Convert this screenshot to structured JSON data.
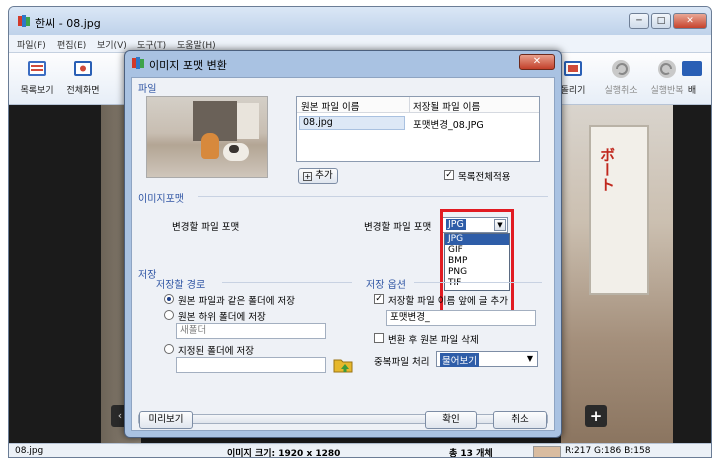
{
  "app": {
    "title": "한씨 - 08.jpg",
    "window_controls": [
      "─",
      "□",
      "✕"
    ],
    "menu": [
      "파일(F)",
      "편집(E)",
      "보기(V)",
      "도구(T)",
      "도움말(H)"
    ],
    "toolbar": {
      "left": [
        "목록보기",
        "전체화면"
      ],
      "right": [
        "돌리기",
        "실행취소",
        "실행반복",
        "배"
      ]
    },
    "viewer": {
      "sign_text": "ボート",
      "plus_label": "+",
      "arrow_label": "‹"
    },
    "status": {
      "filename": "08.jpg",
      "image_size": "이미지 크기: 1920 x 1280",
      "total": "총 13 개체",
      "color_readout": "R:217 G:186 B:158"
    }
  },
  "dialog": {
    "title": "이미지 포맷 변환",
    "close_label": "✕",
    "file_section": {
      "title": "파일",
      "col_original": "원본 파일 이름",
      "col_saved": "저장될 파일 이름",
      "rows": [
        {
          "original": "08.jpg",
          "saved": "포맷변경_08.JPG"
        }
      ],
      "add_label": "추가",
      "apply_all_label": "목록전체적용",
      "apply_all_checked": true
    },
    "format_section": {
      "title": "이미지포맷",
      "source_label": "변경할 파일 포맷",
      "target_label": "변경할 파일 포맷",
      "selected": "JPG",
      "options": [
        "JPG",
        "GIF",
        "BMP",
        "PNG",
        "TIF"
      ]
    },
    "save_section": {
      "title": "저장",
      "path_title": "저장할 경로",
      "options": [
        {
          "label": "원본 파일과 같은 폴더에 저장",
          "checked": true
        },
        {
          "label": "원본 하위 폴더에 저장",
          "checked": false
        },
        {
          "label": "지정된 폴더에 저장",
          "checked": false
        }
      ],
      "subfolder_placeholder": "새폴더",
      "custom_folder_value": "",
      "options_title": "저장 옵션",
      "prefix_label": "저장할 파일 이름 앞에 글 추가",
      "prefix_checked": true,
      "prefix_value": "포맷변경_",
      "delete_label": "변환 후 원본 파일 삭제",
      "delete_checked": false,
      "duplicate_label": "중복파일 처리",
      "duplicate_value": "물어보기"
    },
    "footer": {
      "preview_label": "미리보기",
      "ok_label": "확인",
      "cancel_label": "취소"
    }
  },
  "colors": {
    "highlight": "#e11b22",
    "selection": "#2e5da8",
    "section_title": "#2f55a4"
  }
}
